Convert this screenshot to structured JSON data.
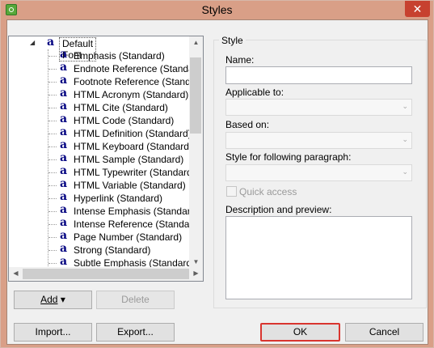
{
  "window": {
    "title": "Styles",
    "close_symbol": "✕",
    "icon": "app-icon",
    "accent": "#d99f87"
  },
  "tree": {
    "expander_symbol": "◢",
    "root": {
      "icon": "a",
      "label": "Default Font"
    },
    "items": [
      {
        "icon": "a",
        "label": "Emphasis (Standard)"
      },
      {
        "icon": "a",
        "label": "Endnote Reference (Standard)"
      },
      {
        "icon": "a",
        "label": "Footnote Reference (Standard)"
      },
      {
        "icon": "a",
        "label": "HTML Acronym (Standard)"
      },
      {
        "icon": "a",
        "label": "HTML Cite (Standard)"
      },
      {
        "icon": "a",
        "label": "HTML Code (Standard)"
      },
      {
        "icon": "a",
        "label": "HTML Definition (Standard)"
      },
      {
        "icon": "a",
        "label": "HTML Keyboard (Standard)"
      },
      {
        "icon": "a",
        "label": "HTML Sample (Standard)"
      },
      {
        "icon": "a",
        "label": "HTML Typewriter (Standard)"
      },
      {
        "icon": "a",
        "label": "HTML Variable (Standard)"
      },
      {
        "icon": "a",
        "label": "Hyperlink (Standard)"
      },
      {
        "icon": "a",
        "label": "Intense Emphasis (Standard)"
      },
      {
        "icon": "a",
        "label": "Intense Reference (Standard)"
      },
      {
        "icon": "a",
        "label": "Page Number (Standard)"
      },
      {
        "icon": "a",
        "label": "Strong (Standard)"
      },
      {
        "icon": "a",
        "label": "Subtle Emphasis (Standard)"
      }
    ],
    "scroll_up": "▲",
    "scroll_down": "▼",
    "scroll_left": "◀",
    "scroll_right": "▶"
  },
  "buttons": {
    "add": "Add",
    "add_caret": "▾",
    "delete": "Delete",
    "import": "Import...",
    "export": "Export...",
    "ok": "OK",
    "cancel": "Cancel"
  },
  "style_group": {
    "title": "Style",
    "name_label": "Name:",
    "name_value": "",
    "applicable_label": "Applicable to:",
    "based_label": "Based on:",
    "following_label": "Style for following paragraph:",
    "combo_arrow": "⌄",
    "quick_access_label": "Quick access",
    "description_label": "Description and preview:"
  }
}
